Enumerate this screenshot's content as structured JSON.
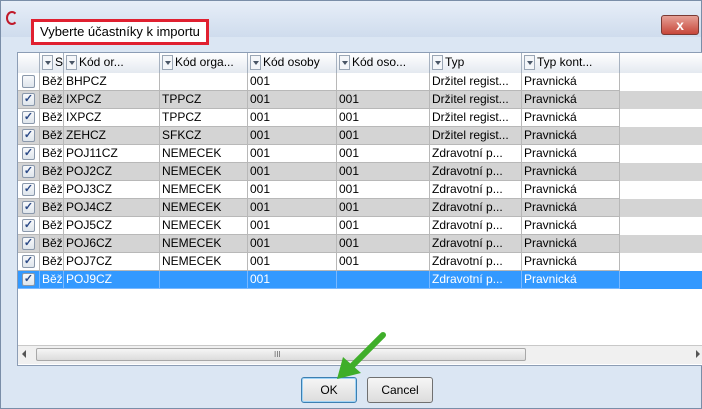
{
  "dialog": {
    "title": "Vyberte účastníky k importu",
    "close_label": "x",
    "ok_label": "OK",
    "cancel_label": "Cancel"
  },
  "grid": {
    "columns": [
      "Stav",
      "Kód or...",
      "Kód orga...",
      "Kód osoby",
      "Kód oso...",
      "Typ",
      "Typ kont..."
    ],
    "rows": [
      {
        "checked": false,
        "stav": "Běží",
        "kod_or": "BHPCZ",
        "kod_orga": "",
        "kod_osoby": "001",
        "kod_oso": "",
        "typ": "Držitel regist...",
        "typ_kont": "Pravnická",
        "style": "white"
      },
      {
        "checked": true,
        "stav": "Běží",
        "kod_or": "IXPCZ",
        "kod_orga": "TPPCZ",
        "kod_osoby": "001",
        "kod_oso": "001",
        "typ": "Držitel regist...",
        "typ_kont": "Pravnická",
        "style": "grey"
      },
      {
        "checked": true,
        "stav": "Běží",
        "kod_or": "IXPCZ",
        "kod_orga": "TPPCZ",
        "kod_osoby": "001",
        "kod_oso": "001",
        "typ": "Držitel regist...",
        "typ_kont": "Pravnická",
        "style": "white"
      },
      {
        "checked": true,
        "stav": "Běží",
        "kod_or": "ZEHCZ",
        "kod_orga": "SFKCZ",
        "kod_osoby": "001",
        "kod_oso": "001",
        "typ": "Držitel regist...",
        "typ_kont": "Pravnická",
        "style": "grey"
      },
      {
        "checked": true,
        "stav": "Běží",
        "kod_or": "POJ11CZ",
        "kod_orga": "NEMECEK",
        "kod_osoby": "001",
        "kod_oso": "001",
        "typ": "Zdravotní p...",
        "typ_kont": "Pravnická",
        "style": "white"
      },
      {
        "checked": true,
        "stav": "Běží",
        "kod_or": "POJ2CZ",
        "kod_orga": "NEMECEK",
        "kod_osoby": "001",
        "kod_oso": "001",
        "typ": "Zdravotní p...",
        "typ_kont": "Pravnická",
        "style": "grey"
      },
      {
        "checked": true,
        "stav": "Běží",
        "kod_or": "POJ3CZ",
        "kod_orga": "NEMECEK",
        "kod_osoby": "001",
        "kod_oso": "001",
        "typ": "Zdravotní p...",
        "typ_kont": "Pravnická",
        "style": "white"
      },
      {
        "checked": true,
        "stav": "Běží",
        "kod_or": "POJ4CZ",
        "kod_orga": "NEMECEK",
        "kod_osoby": "001",
        "kod_oso": "001",
        "typ": "Zdravotní p...",
        "typ_kont": "Pravnická",
        "style": "grey"
      },
      {
        "checked": true,
        "stav": "Běží",
        "kod_or": "POJ5CZ",
        "kod_orga": "NEMECEK",
        "kod_osoby": "001",
        "kod_oso": "001",
        "typ": "Zdravotní p...",
        "typ_kont": "Pravnická",
        "style": "white"
      },
      {
        "checked": true,
        "stav": "Běží",
        "kod_or": "POJ6CZ",
        "kod_orga": "NEMECEK",
        "kod_osoby": "001",
        "kod_oso": "001",
        "typ": "Zdravotní p...",
        "typ_kont": "Pravnická",
        "style": "grey"
      },
      {
        "checked": true,
        "stav": "Běží",
        "kod_or": "POJ7CZ",
        "kod_orga": "NEMECEK",
        "kod_osoby": "001",
        "kod_oso": "001",
        "typ": "Zdravotní p...",
        "typ_kont": "Pravnická",
        "style": "white"
      },
      {
        "checked": true,
        "stav": "Běží",
        "kod_or": "POJ9CZ",
        "kod_orga": "",
        "kod_osoby": "001",
        "kod_oso": "",
        "typ": "Zdravotní p...",
        "typ_kont": "Pravnická",
        "style": "sel"
      }
    ]
  },
  "colors": {
    "title_highlight": "#e02030",
    "selection": "#3399ff",
    "annotation_arrow": "#3fae2a"
  }
}
